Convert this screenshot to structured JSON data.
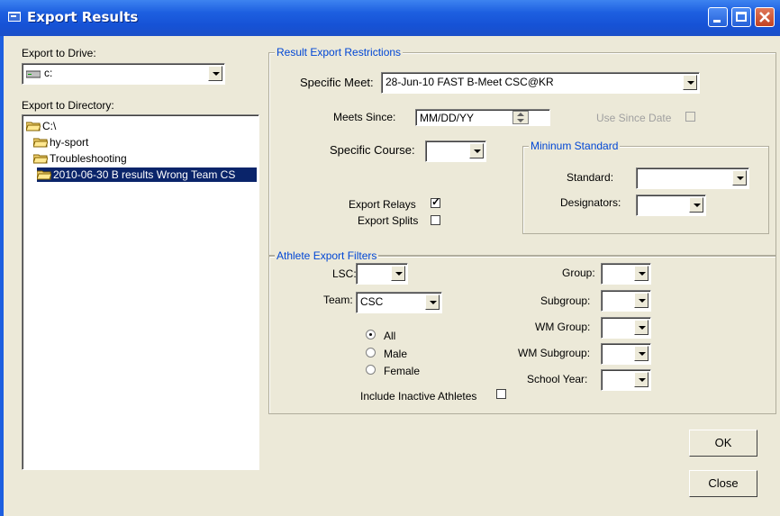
{
  "window": {
    "title": "Export Results"
  },
  "left": {
    "drive_label": "Export to Drive:",
    "drive_value": "c:",
    "dir_label": "Export to Directory:",
    "tree": [
      {
        "label": "C:\\"
      },
      {
        "label": "hy-sport"
      },
      {
        "label": "Troubleshooting"
      },
      {
        "label": "2010-06-30 B results Wrong Team CS"
      }
    ]
  },
  "restrictions": {
    "title": "Result Export Restrictions",
    "specific_meet_label": "Specific Meet:",
    "specific_meet_value": "28-Jun-10 FAST B-Meet CSC@KR",
    "meets_since_label": "Meets Since:",
    "meets_since_value": "MM/DD/YY",
    "use_since_date_label": "Use Since Date",
    "specific_course_label": "Specific Course:",
    "specific_course_value": "",
    "export_relays_label": "Export Relays",
    "export_relays_checked": true,
    "export_splits_label": "Export Splits",
    "export_splits_checked": false,
    "min_standard": {
      "title": "Mininum Standard",
      "standard_label": "Standard:",
      "standard_value": "",
      "designators_label": "Designators:",
      "designators_value": ""
    }
  },
  "athlete": {
    "title": "Athlete Export Filters",
    "lsc_label": "LSC:",
    "lsc_value": "",
    "team_label": "Team:",
    "team_value": "CSC",
    "gender_options": [
      "All",
      "Male",
      "Female"
    ],
    "gender_selected": "All",
    "include_inactive_label": "Include Inactive Athletes",
    "group_label": "Group:",
    "subgroup_label": "Subgroup:",
    "wm_group_label": "WM Group:",
    "wm_subgroup_label": "WM Subgroup:",
    "school_year_label": "School Year:"
  },
  "buttons": {
    "ok": "OK",
    "close": "Close"
  },
  "colors": {
    "title_bar": "#1d5fe0",
    "group_title": "#0046d5",
    "selection": "#0a246a"
  }
}
